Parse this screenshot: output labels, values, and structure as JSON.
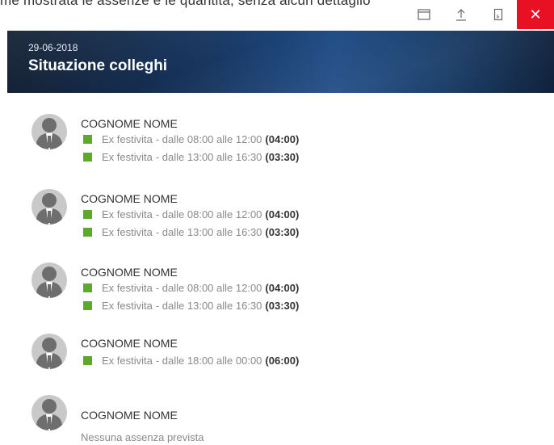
{
  "top_text": "me mostrata le assenze e le quantità, senza alcun dettaglio",
  "window_controls": {
    "restore_label": "",
    "share_label": "",
    "bookmark_label": "",
    "close_label": "✕"
  },
  "banner": {
    "date": "29-06-2018",
    "title": "Situazione colleghi"
  },
  "colleagues": [
    {
      "name": "COGNOME NOME",
      "absences": [
        {
          "type": "Ex festivita",
          "detail": "- dalle 08:00 alle 12:00",
          "duration": "(04:00)"
        },
        {
          "type": "Ex festivita",
          "detail": "- dalle 13:00 alle 16:30",
          "duration": "(03:30)"
        }
      ]
    },
    {
      "name": "COGNOME NOME",
      "absences": [
        {
          "type": "Ex festivita",
          "detail": "- dalle 08:00 alle 12:00",
          "duration": "(04:00)"
        },
        {
          "type": "Ex festivita",
          "detail": "- dalle 13:00 alle 16:30",
          "duration": "(03:30)"
        }
      ]
    },
    {
      "name": "COGNOME NOME",
      "absences": [
        {
          "type": "Ex festivita",
          "detail": "- dalle 08:00 alle 12:00",
          "duration": "(04:00)"
        },
        {
          "type": "Ex festivita",
          "detail": "- dalle 13:00 alle 16:30",
          "duration": "(03:30)"
        }
      ]
    },
    {
      "name": "COGNOME NOME",
      "absences": [
        {
          "type": "Ex festivita",
          "detail": "- dalle 18:00 alle 00:00",
          "duration": "(06:00)"
        }
      ]
    },
    {
      "name": "COGNOME NOME",
      "absences": [],
      "empty_text": "Nessuna assenza prevista"
    }
  ],
  "colors": {
    "absence_marker": "#5daa2a",
    "close_button": "#e81123",
    "banner": "#17355e"
  }
}
